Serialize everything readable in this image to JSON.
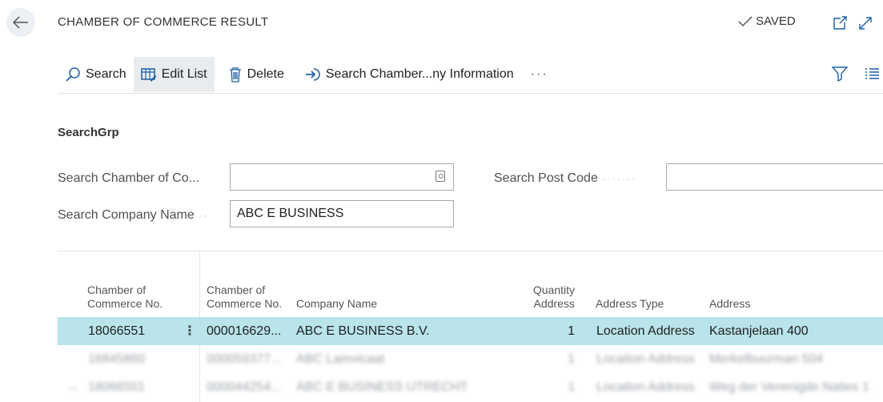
{
  "header": {
    "title": "CHAMBER OF COMMERCE RESULT",
    "saved": "SAVED"
  },
  "toolbar": {
    "search": "Search",
    "edit_list": "Edit List",
    "delete": "Delete",
    "search_info": "Search Chamber...ny Information",
    "more": "···"
  },
  "group": {
    "title": "SearchGrp"
  },
  "fields": {
    "coc_label": "Search Chamber of Co...",
    "coc_value": "",
    "post_label": "Search Post Code",
    "post_value": "",
    "company_label": "Search Company Name",
    "company_value": "ABC E BUSINESS"
  },
  "table": {
    "headers": {
      "coc_no": "Chamber of Commerce No.",
      "coc_no2": "Chamber of Commerce No.",
      "company": "Company Name",
      "qty": "Quantity Address",
      "type": "Address Type",
      "address": "Address"
    },
    "rows": [
      {
        "coc": "18066551",
        "coc2": "000016629...",
        "company": "ABC E BUSINESS B.V.",
        "qty": "1",
        "type": "Location Address",
        "address": "Kastanjelaan 400"
      },
      {
        "coc": "16845860",
        "coc2": "000059377...",
        "company": "ABC Lamvicaat",
        "qty": "1",
        "type": "Location Address",
        "address": "Merkelbuurman 504"
      },
      {
        "coc": "18066551",
        "coc2": "000044254...",
        "company": "ABC E BUSINESS UTRECHT",
        "qty": "1",
        "type": "Location Address",
        "address": "Weg der Verenigde Naties 1"
      }
    ]
  },
  "colors": {
    "accent": "#1e5fa5",
    "selected_row": "#b8e4ea"
  }
}
